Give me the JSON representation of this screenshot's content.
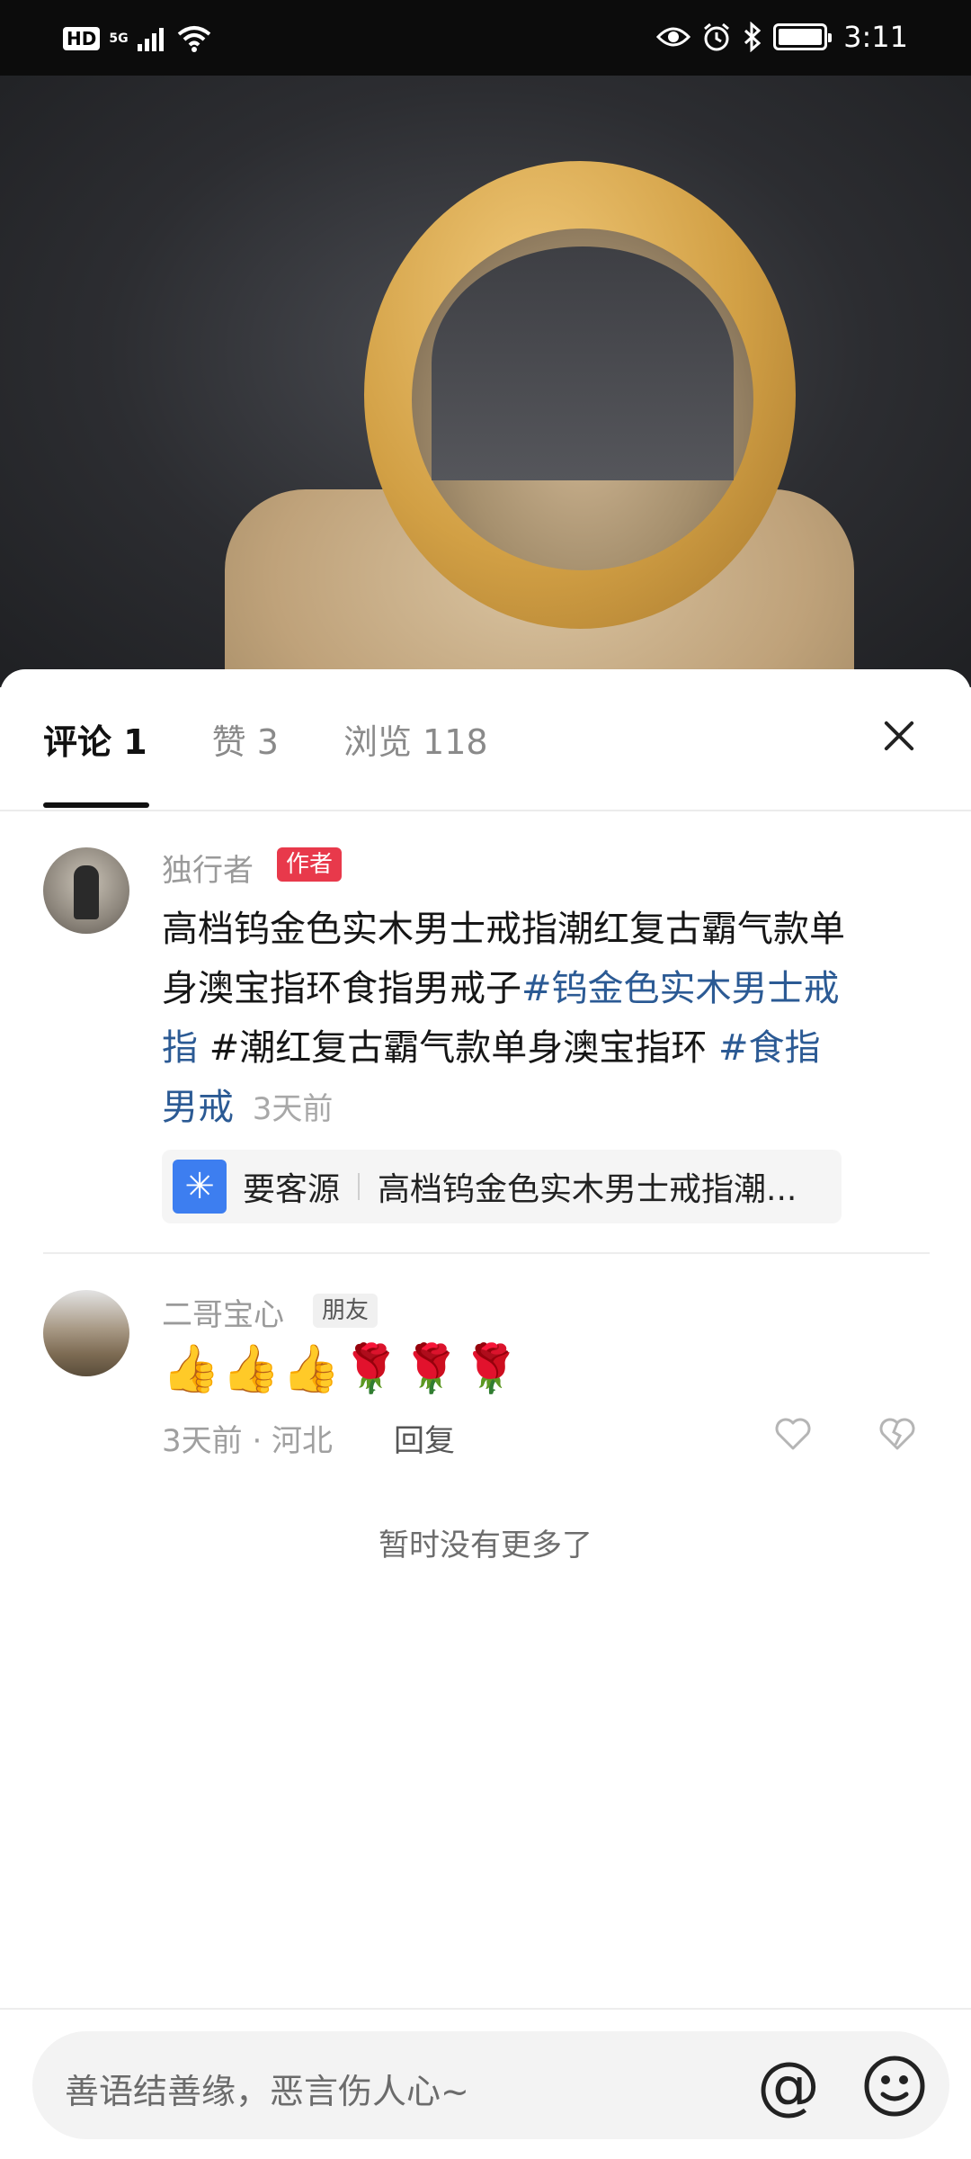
{
  "status_bar": {
    "hd": "HD",
    "network": "5G",
    "time": "3:11"
  },
  "tabs": [
    {
      "label": "评论 1",
      "active": true
    },
    {
      "label": "赞 3",
      "active": false
    },
    {
      "label": "浏览 118",
      "active": false
    }
  ],
  "comment_1": {
    "author": "独行者",
    "badge": "作者",
    "text_plain": "高档钨金色实木男士戒指潮红复古霸气款单身澳宝指环食指男戒子",
    "hashtag_1": "#钨金色实木男士戒指",
    "text_plain_2": "#潮红复古霸气款单身澳宝指环",
    "hashtag_2": "#食指男戒",
    "time": "3天前",
    "promo": {
      "title": "要客源",
      "description": "高档钨金色实木男士戒指潮..."
    }
  },
  "comment_2": {
    "author": "二哥宝心",
    "badge": "朋友",
    "emojis": "👍👍👍🌹🌹🌹",
    "meta": "3天前 · 河北",
    "reply": "回复"
  },
  "no_more": "暂时没有更多了",
  "input": {
    "placeholder": "善语结善缘，恶言伤人心~",
    "at": "@"
  },
  "colors": {
    "hashtag": "#2b5a94",
    "author_badge": "#e8394b",
    "promo_icon": "#3d7ef0"
  }
}
